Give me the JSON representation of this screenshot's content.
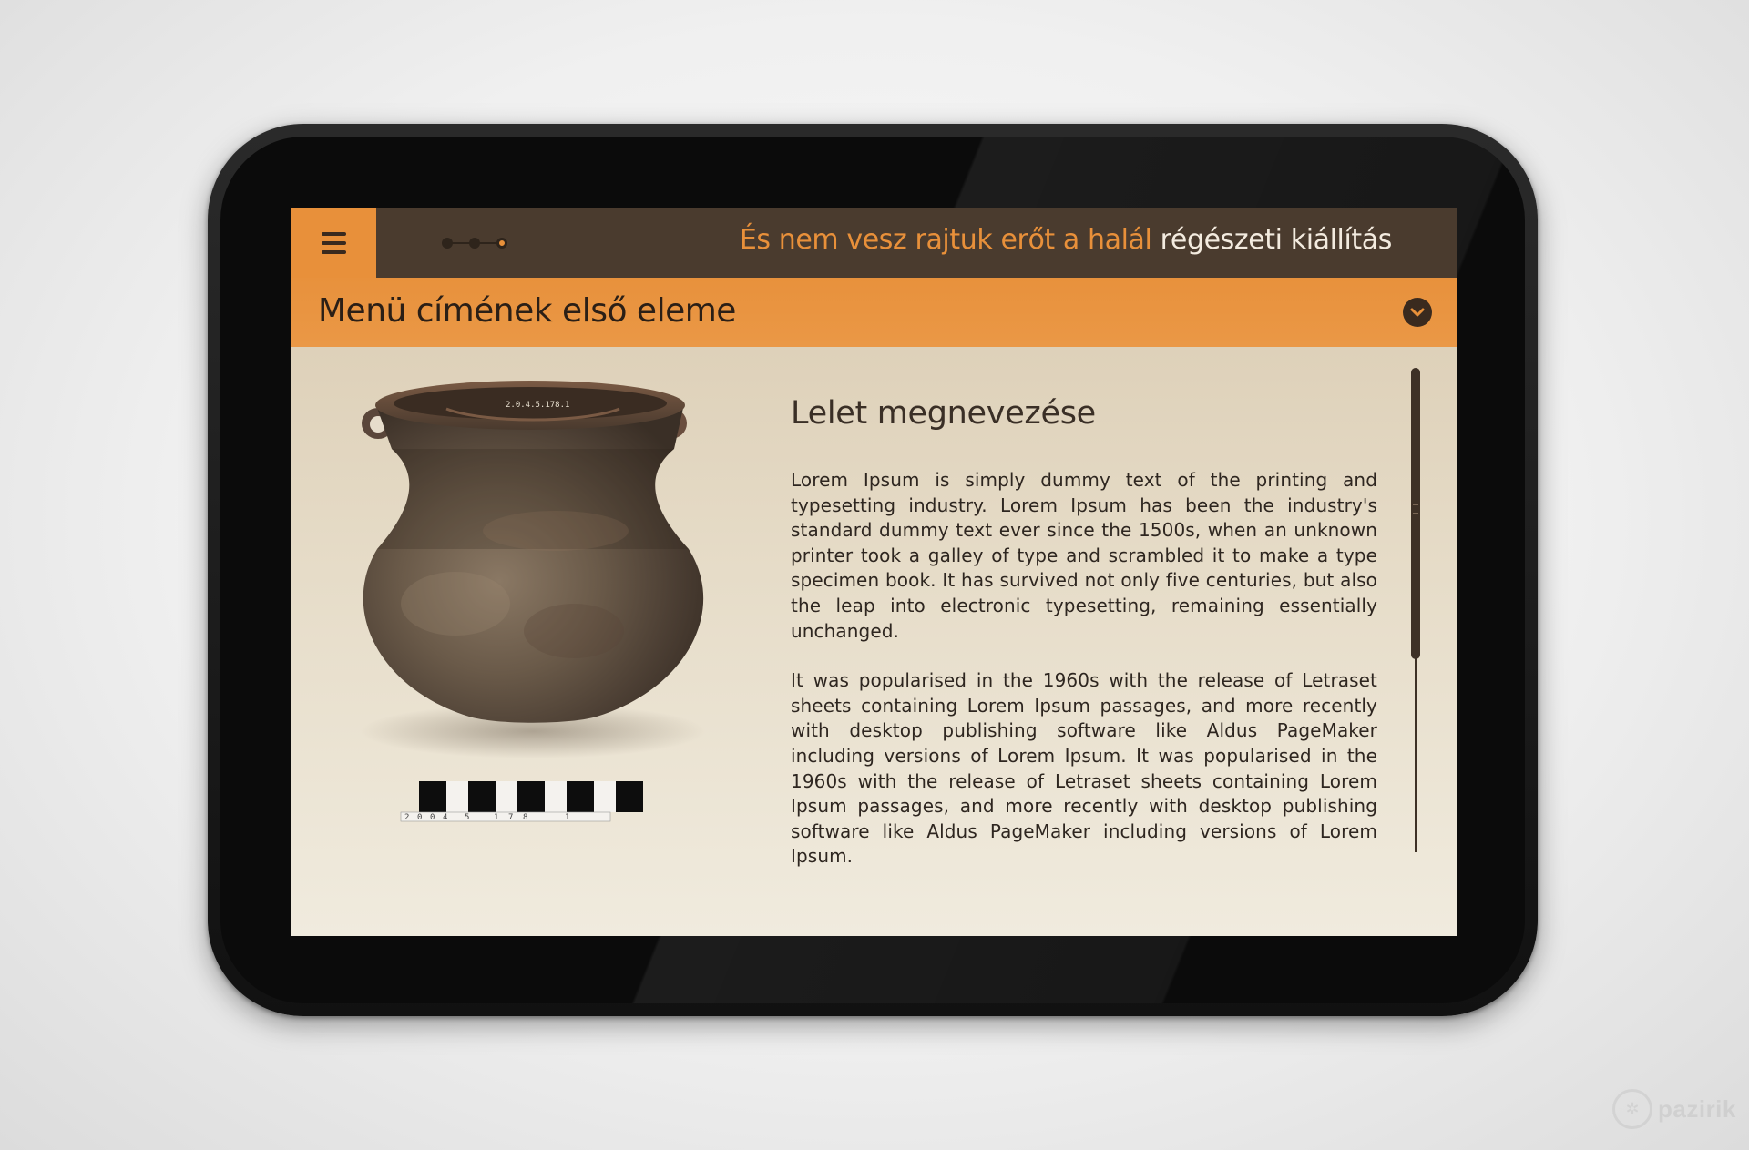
{
  "header": {
    "title_highlight": "És nem vesz rajtuk erőt a halál",
    "title_rest": "régészeti kiállítás",
    "pager": {
      "total": 3,
      "active_index": 3
    },
    "menu_icon": "hamburger-icon"
  },
  "menubar": {
    "label": "Menü címének első eleme",
    "expand_icon": "chevron-down-icon"
  },
  "content": {
    "title": "Lelet megnevezése",
    "paragraphs": [
      "Lorem Ipsum is simply dummy text of the printing and typesetting industry. Lorem Ipsum has been the industry's standard dummy text ever since the 1500s, when an unknown printer took a galley of type and scrambled it to make a type specimen book. It has survived not only five centuries, but also the leap into electronic typesetting, remaining essentially unchanged.",
      "It was popularised in the 1960s with the release of Letraset sheets containing Lorem Ipsum passages, and more recently with desktop publishing software like Aldus PageMaker including versions of Lorem Ipsum. It was popularised in the 1960s with the release of Letraset sheets containing Lorem Ipsum passages, and more recently with desktop publishing software like Aldus PageMaker including versions of Lorem Ipsum."
    ],
    "artifact": {
      "pot_inscription": "2.0.4.5.178.1",
      "scale_digits": [
        "2",
        "0",
        "0",
        "4",
        "5",
        "1",
        "7",
        "8",
        "1"
      ]
    },
    "scroll_position": 0
  },
  "colors": {
    "accent": "#e8903a",
    "topbar": "#4a3b2e",
    "dark_text": "#2b1f16",
    "header_light_text": "#f3ebdf"
  },
  "watermark": {
    "text": "pazirik"
  }
}
